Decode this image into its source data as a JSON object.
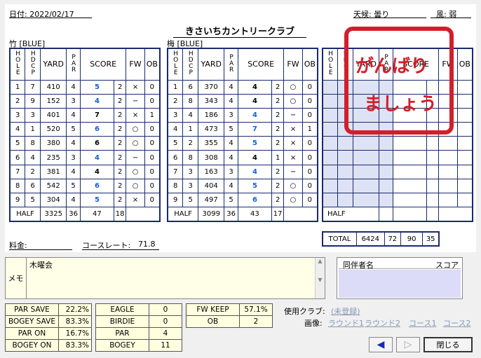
{
  "header": {
    "date_label": "日付: 2022/02/17",
    "weather_label": "天候: 曇り",
    "wind_label": "風: 弱",
    "club_name": "きさいちカントリークラブ"
  },
  "columns": {
    "hole": "HOLE",
    "hdcp": "HDCP",
    "yard": "YARD",
    "par": "PAR",
    "score": "SCORE",
    "fw": "FW",
    "ob": "OB"
  },
  "course1": {
    "name": "竹 [BLUE]",
    "rows": [
      [
        "1",
        "7",
        "410",
        "4",
        "5",
        "2",
        "×",
        "0"
      ],
      [
        "2",
        "9",
        "152",
        "3",
        "4",
        "2",
        "−",
        "0"
      ],
      [
        "3",
        "3",
        "401",
        "4",
        "7",
        "2",
        "×",
        "1"
      ],
      [
        "4",
        "1",
        "520",
        "5",
        "6",
        "2",
        "○",
        "0"
      ],
      [
        "5",
        "8",
        "380",
        "4",
        "6",
        "2",
        "○",
        "0"
      ],
      [
        "6",
        "4",
        "235",
        "3",
        "4",
        "2",
        "−",
        "0"
      ],
      [
        "7",
        "2",
        "381",
        "4",
        "4",
        "2",
        "○",
        "0"
      ],
      [
        "8",
        "6",
        "542",
        "5",
        "6",
        "2",
        "○",
        "0"
      ],
      [
        "9",
        "5",
        "304",
        "4",
        "5",
        "2",
        "×",
        "0"
      ]
    ],
    "score_colors": [
      "blue",
      "blue",
      "black",
      "blue",
      "black",
      "blue",
      "black",
      "blue",
      "blue"
    ],
    "half": {
      "label": "HALF",
      "yard": "3325",
      "par": "36",
      "score": "47",
      "putt": "18"
    }
  },
  "course2": {
    "name": "梅 [BLUE]",
    "rows": [
      [
        "1",
        "6",
        "370",
        "4",
        "4",
        "2",
        "○",
        "0"
      ],
      [
        "2",
        "8",
        "343",
        "4",
        "4",
        "2",
        "○",
        "0"
      ],
      [
        "3",
        "4",
        "186",
        "3",
        "4",
        "2",
        "−",
        "0"
      ],
      [
        "4",
        "1",
        "473",
        "5",
        "7",
        "2",
        "×",
        "1"
      ],
      [
        "5",
        "2",
        "355",
        "4",
        "5",
        "2",
        "×",
        "0"
      ],
      [
        "6",
        "8",
        "308",
        "4",
        "4",
        "1",
        "×",
        "0"
      ],
      [
        "7",
        "3",
        "163",
        "3",
        "4",
        "2",
        "−",
        "0"
      ],
      [
        "8",
        "3",
        "404",
        "4",
        "5",
        "2",
        "○",
        "0"
      ],
      [
        "9",
        "5",
        "497",
        "5",
        "6",
        "2",
        "○",
        "0"
      ]
    ],
    "score_colors": [
      "black",
      "black",
      "blue",
      "blue",
      "blue",
      "black",
      "blue",
      "blue",
      "blue"
    ],
    "half": {
      "label": "HALF",
      "yard": "3099",
      "par": "36",
      "score": "43",
      "putt": "17"
    }
  },
  "course3": {
    "half_label": "HALF",
    "total": {
      "label": "TOTAL",
      "yard": "6424",
      "par": "72",
      "score": "90",
      "putt": "35"
    }
  },
  "stamp": {
    "line1": "がんばり",
    "line2": "ましょう"
  },
  "footer": {
    "fee_label": "料金:",
    "rate_label": "コースレート:",
    "rate_value": "71.8"
  },
  "memo": {
    "label": "メモ",
    "text": "木曜会"
  },
  "companions": {
    "name_header": "同伴者名",
    "score_header": "スコア"
  },
  "stats1": [
    [
      "PAR SAVE",
      "22.2%"
    ],
    [
      "BOGEY SAVE",
      "83.3%"
    ],
    [
      "PAR ON",
      "16.7%"
    ],
    [
      "BOGEY ON",
      "83.3%"
    ]
  ],
  "stats2": [
    [
      "EAGLE",
      "0"
    ],
    [
      "BIRDIE",
      "0"
    ],
    [
      "PAR",
      "4"
    ],
    [
      "BOGEY",
      "11"
    ]
  ],
  "stats3": [
    [
      "FW KEEP",
      "57.1%"
    ],
    [
      "OB",
      "2"
    ]
  ],
  "clubs": {
    "label": "使用クラブ:",
    "value": "(未登録)"
  },
  "images": {
    "label": "画像:",
    "round1": "ラウンド1",
    "round2": "ラウンド2",
    "course1": "コース1",
    "course2": "コース2"
  },
  "buttons": {
    "prev": "◀",
    "next": "▷",
    "close": "閉じる"
  },
  "colors": {
    "border": "#1a2a6c",
    "score_blue": "#1560d8",
    "stamp_red": "#d21f2a"
  }
}
